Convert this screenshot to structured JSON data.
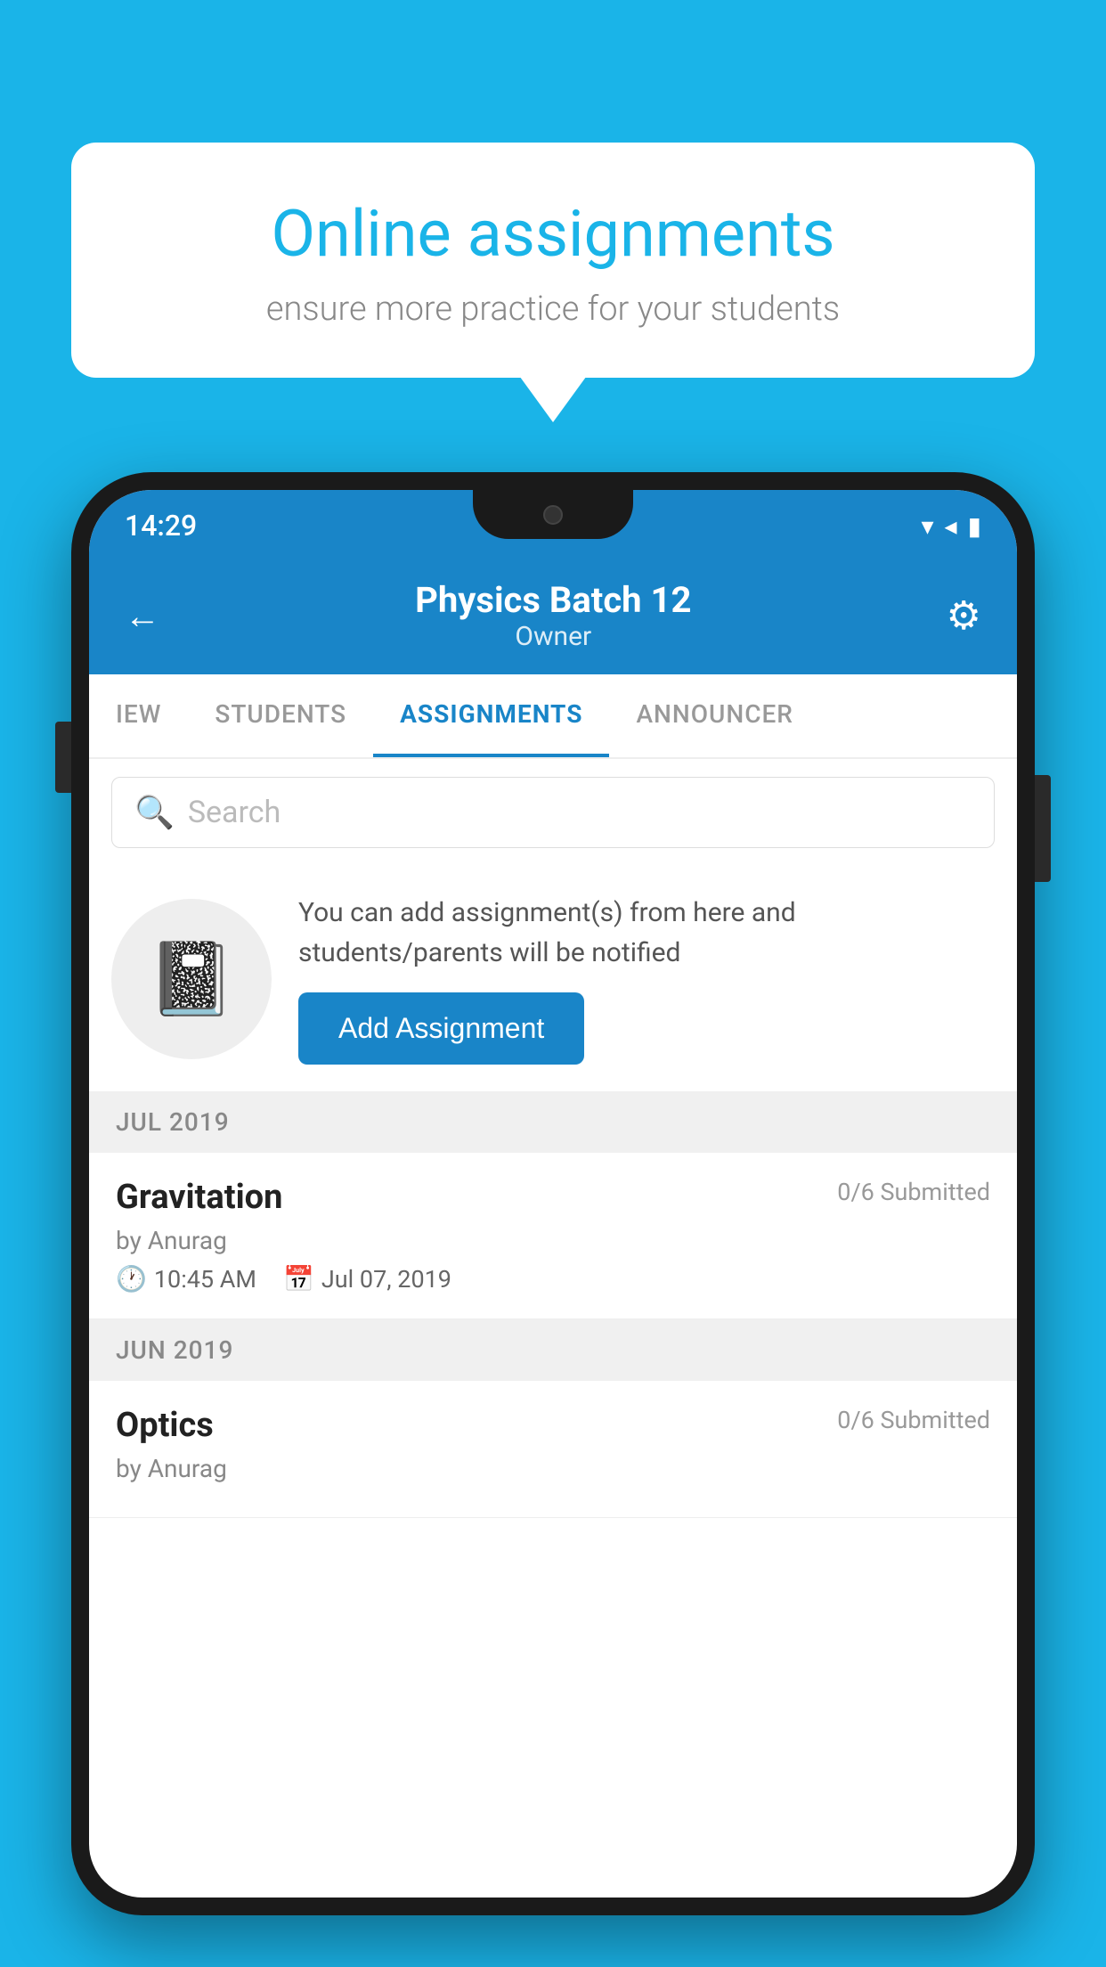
{
  "background": {
    "color": "#1ab4e8"
  },
  "speech_bubble": {
    "title": "Online assignments",
    "subtitle": "ensure more practice for your students"
  },
  "phone": {
    "status_bar": {
      "time": "14:29"
    },
    "header": {
      "title": "Physics Batch 12",
      "subtitle": "Owner",
      "back_label": "←",
      "gear_label": "⚙"
    },
    "tabs": [
      {
        "label": "IEW",
        "active": false
      },
      {
        "label": "STUDENTS",
        "active": false
      },
      {
        "label": "ASSIGNMENTS",
        "active": true
      },
      {
        "label": "ANNOUNCER",
        "active": false
      }
    ],
    "search": {
      "placeholder": "Search"
    },
    "info_card": {
      "message": "You can add assignment(s) from here and students/parents will be notified",
      "button_label": "Add Assignment"
    },
    "assignments": [
      {
        "month": "JUL 2019",
        "items": [
          {
            "name": "Gravitation",
            "submitted": "0/6 Submitted",
            "by": "by Anurag",
            "time": "10:45 AM",
            "date": "Jul 07, 2019"
          }
        ]
      },
      {
        "month": "JUN 2019",
        "items": [
          {
            "name": "Optics",
            "submitted": "0/6 Submitted",
            "by": "by Anurag",
            "time": "",
            "date": ""
          }
        ]
      }
    ]
  }
}
